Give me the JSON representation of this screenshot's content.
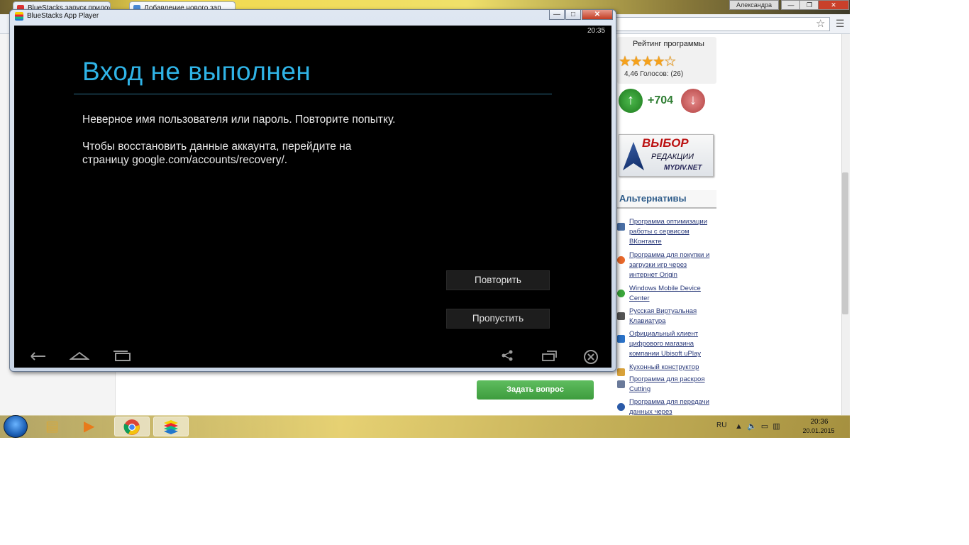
{
  "browser": {
    "tabs": [
      {
        "title": "BlueStacks запуск прилож"
      },
      {
        "title": "Добавление нового зап"
      }
    ],
    "user": "Александра",
    "window_buttons": {
      "minimize": "—",
      "restore": "❐",
      "close": "✕"
    }
  },
  "sidebar": {
    "rating_title": "Рейтинг программы",
    "stars": "★★★★☆",
    "rating_text": "4,46 Голосов: (26)",
    "vote_count": "+704",
    "badge": {
      "line1": "ВЫБОР",
      "line2": "РЕДАКЦИИ",
      "line3": "MYDIV.NET"
    },
    "alternatives_title": "Альтернативы",
    "alternatives": [
      {
        "label": "Программа оптимизации работы с сервисом ВКонтакте",
        "color": "#4a6fa5"
      },
      {
        "label": "Программа для покупки и загрузки игр через интернет Origin",
        "color": "#e8682a"
      },
      {
        "label": "Windows Mobile Device Center",
        "color": "#3aa63a"
      },
      {
        "label": "Русская Виртуальная Клавиатура",
        "color": "#555555"
      },
      {
        "label": "Официальный клиент цифрового магазина компании Ubisoft uPlay",
        "color": "#2a72c8"
      },
      {
        "label": "Кухонный конструктор",
        "color": "#d9a23a"
      },
      {
        "label": "Программа для раскроя Cutting",
        "color": "#6a7a9a"
      },
      {
        "label": "Программа для передачи данных через",
        "color": "#2a5aa8"
      }
    ]
  },
  "page": {
    "ask_button": "Задать вопрос"
  },
  "bluestacks": {
    "title": "BlueStacks App Player",
    "clock": "20:35",
    "dialog": {
      "title": "Вход не выполнен",
      "line1": "Неверное имя пользователя или пароль. Повторите попытку.",
      "line2a": "Чтобы восстановить данные аккаунта, перейдите на",
      "line2b": "страницу google.com/accounts/recovery/.",
      "retry": "Повторить",
      "skip": "Пропустить"
    }
  },
  "taskbar": {
    "language": "RU",
    "time": "20:36",
    "date": "20.01.2015"
  }
}
